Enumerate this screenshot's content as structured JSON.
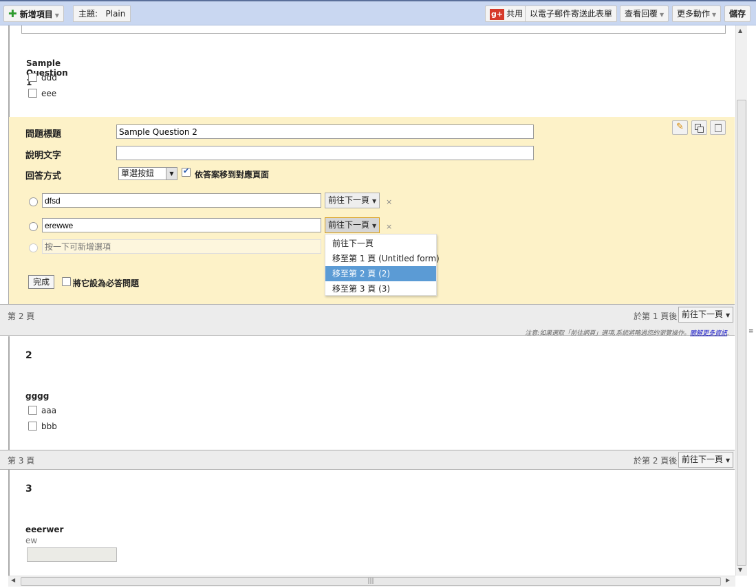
{
  "toolbar": {
    "new_item": "新增項目",
    "theme_label": "主題:",
    "theme_value": "Plain",
    "share": "共用",
    "email_form": "以電子郵件寄送此表單",
    "view_responses": "查看回覆",
    "more_actions": "更多動作",
    "save": "儲存"
  },
  "page1": {
    "question1": {
      "title": "Sample Question 1",
      "options": [
        "ddd",
        "eee"
      ]
    },
    "editor": {
      "title_label": "問題標題",
      "title_value": "Sample Question 2",
      "help_label": "說明文字",
      "help_value": "",
      "type_label": "回答方式",
      "type_value": "單選按鈕",
      "goto_page_label": "依答案移到對應頁面",
      "answers": [
        {
          "text": "dfsd",
          "goto": "前往下一頁"
        },
        {
          "text": "erewwe",
          "goto": "前往下一頁"
        }
      ],
      "add_option_placeholder": "按一下可新增選項",
      "done": "完成",
      "required_label": "將它設為必答問題",
      "remove": "×"
    },
    "dropdown": [
      "前往下一頁",
      "移至第 1 頁 (Untitled form)",
      "移至第 2 頁 (2)",
      "移至第 3 頁 (3)"
    ]
  },
  "page2": {
    "header": "第 2 頁",
    "after_label": "於第 1 頁後",
    "after_value": "前往下一頁",
    "note": "注意:如果選取「前往網頁」選項,系統將略過您的瀏覽操作。",
    "note_link": "瞭解更多資訊",
    "title": "2",
    "question": {
      "title": "gggg",
      "options": [
        "aaa",
        "bbb"
      ]
    }
  },
  "page3": {
    "header": "第 3 頁",
    "after_label": "於第 2 頁後",
    "after_value": "前往下一頁",
    "title": "3",
    "question": {
      "title": "eeerwer",
      "help": "ew"
    }
  },
  "colors": {
    "toolbar_bg": "#c9d7f1",
    "editor_bg": "#fdf2c8",
    "dropdown_selected": "#5b9bd5"
  }
}
